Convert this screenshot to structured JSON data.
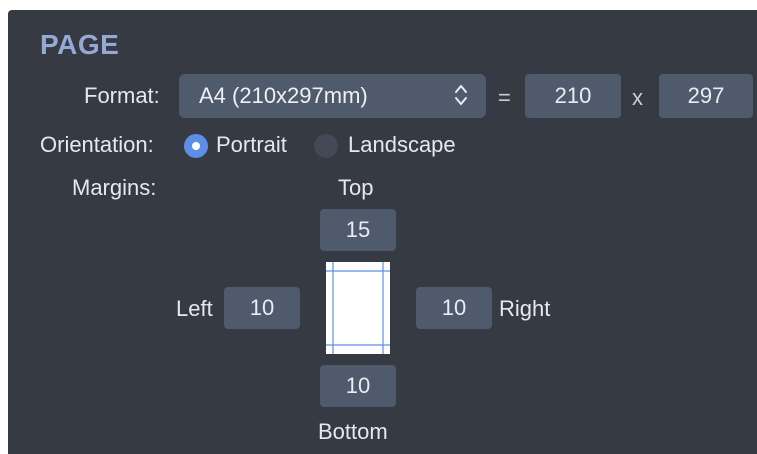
{
  "section": {
    "title": "PAGE"
  },
  "format": {
    "label": "Format:",
    "selected": "A4 (210x297mm)",
    "equals": "=",
    "width": "210",
    "times": "x",
    "height": "297"
  },
  "orientation": {
    "label": "Orientation:",
    "options": [
      {
        "label": "Portrait",
        "selected": true
      },
      {
        "label": "Landscape",
        "selected": false
      }
    ]
  },
  "margins": {
    "label": "Margins:",
    "top_label": "Top",
    "top": "15",
    "left_label": "Left",
    "left": "10",
    "right_label": "Right",
    "right": "10",
    "bottom_label": "Bottom",
    "bottom": "10"
  },
  "colors": {
    "panel": "#363a42",
    "title": "#94a9d6",
    "field": "#4f5a6c",
    "accent": "#5d8fe8"
  },
  "icons": [
    "chevron-up-down-icon",
    "page-margins-preview-icon"
  ]
}
